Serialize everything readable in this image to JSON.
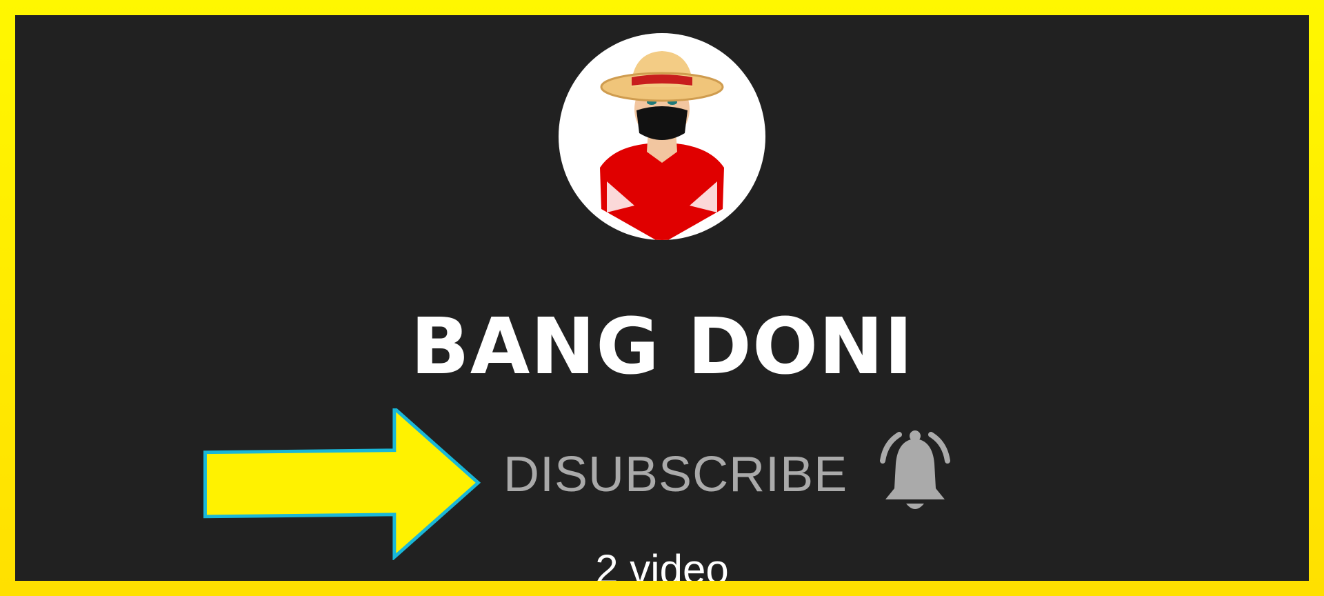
{
  "channel": {
    "name": "BANG DONI",
    "subscribe_label": "DISUBSCRIBE",
    "video_count": "2 video"
  },
  "icons": {
    "avatar": "avatar-icon",
    "bell": "bell-icon",
    "arrow": "arrow-right-icon"
  },
  "colors": {
    "frame": "#fff200",
    "background": "#212121",
    "title": "#ffffff",
    "subscribe": "#aaaaaa",
    "bell": "#aaaaaa",
    "arrow_fill": "#fff200",
    "arrow_stroke": "#19b7d8"
  }
}
